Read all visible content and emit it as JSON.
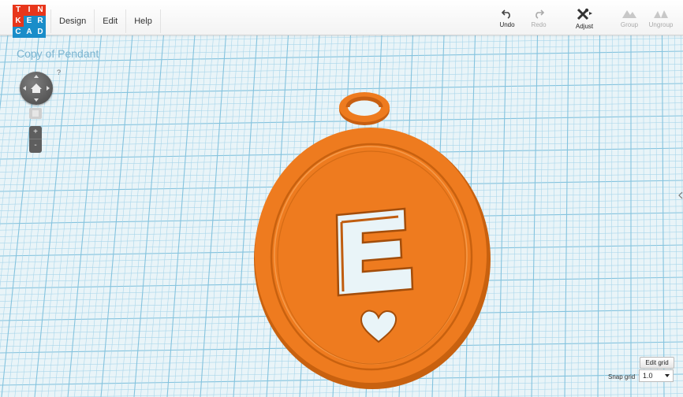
{
  "app": {
    "logo_letters": [
      "T",
      "I",
      "N",
      "K",
      "E",
      "R",
      "C",
      "A",
      "D"
    ],
    "logo_colors": [
      "#e8361b",
      "#e8361b",
      "#e8361b",
      "#e8361b",
      "#1a8dc9",
      "#1a8dc9",
      "#1a8dc9",
      "#1a8dc9",
      "#1a8dc9"
    ]
  },
  "menu": {
    "design": "Design",
    "edit": "Edit",
    "help": "Help"
  },
  "toolbar": {
    "undo": "Undo",
    "redo": "Redo",
    "adjust": "Adjust",
    "group": "Group",
    "ungroup": "Ungroup"
  },
  "design": {
    "title": "Copy of Pendant",
    "pendant_letter": "E",
    "pendant_color": "#ee7b1f"
  },
  "navigation": {
    "help_mark": "?",
    "zoom_in": "+",
    "zoom_out": "-"
  },
  "grid_controls": {
    "edit_grid_label": "Edit grid",
    "snap_grid_label": "Snap grid",
    "snap_grid_value": "1.0"
  },
  "colors": {
    "grid_line": "#a9d6ea",
    "grid_major": "#84c3de",
    "background": "#e9f4f8"
  }
}
